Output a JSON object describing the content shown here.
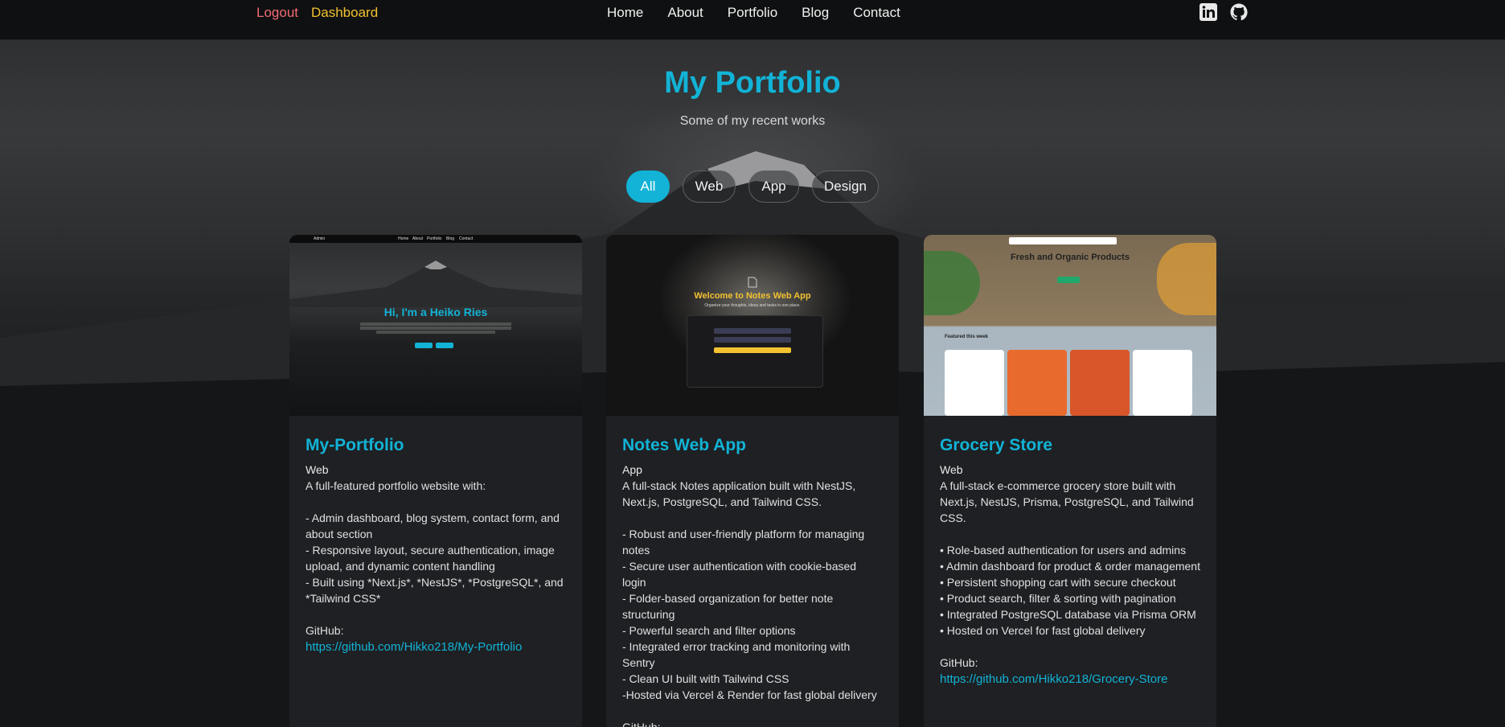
{
  "nav": {
    "logout": "Logout",
    "dashboard": "Dashboard",
    "links": [
      "Home",
      "About",
      "Portfolio",
      "Blog",
      "Contact"
    ],
    "icons": [
      "linkedin-icon",
      "github-icon"
    ]
  },
  "header": {
    "title": "My Portfolio",
    "subtitle": "Some of my recent works"
  },
  "filters": [
    "All",
    "Web",
    "App",
    "Design"
  ],
  "active_filter": "All",
  "projects": [
    {
      "title": "My-Portfolio",
      "category": "Web",
      "description": "A full-featured portfolio website with:\n\n- Admin dashboard, blog system, contact form, and about section\n- Responsive layout, secure authentication, image upload, and dynamic content handling\n- Built using *Next.js*, *NestJS*, *PostgreSQL*, and *Tailwind CSS*",
      "github_label": "GitHub:",
      "github_url": "https://github.com/Hikko218/My-Portfolio",
      "thumb": {
        "heading": "Hi, I'm a Heiko Ries",
        "nav_brand": "Admin",
        "nav_links": [
          "Home",
          "About",
          "Portfolio",
          "Blog",
          "Contact"
        ]
      }
    },
    {
      "title": "Notes Web App",
      "category": "App",
      "description": "A full-stack Notes application built with NestJS, Next.js, PostgreSQL, and Tailwind CSS.\n\n- Robust and user-friendly platform for managing notes\n- Secure user authentication with cookie-based login\n- Folder-based organization for better note structuring\n- Powerful search and filter options\n- Integrated error tracking and monitoring with Sentry\n- Clean UI built with Tailwind CSS\n-Hosted via Vercel & Render for fast global delivery",
      "github_label": "GitHub:",
      "github_url": "",
      "thumb": {
        "heading": "Welcome to Notes Web App",
        "subheading": "Organize your thoughts, ideas and tasks in one place."
      }
    },
    {
      "title": "Grocery Store",
      "category": "Web",
      "description": "A full-stack e-commerce grocery store built with Next.js, NestJS, Prisma, PostgreSQL, and Tailwind CSS.\n\n• Role-based authentication for users and admins\n• Admin dashboard for product & order management\n• Persistent shopping cart with secure checkout\n• Product search, filter & sorting with pagination\n• Integrated PostgreSQL database via Prisma ORM\n• Hosted on Vercel for fast global delivery",
      "github_label": "GitHub:",
      "github_url": "https://github.com/Hikko218/Grocery-Store",
      "thumb": {
        "heading": "Fresh and Organic Products",
        "section": "Featured this week"
      }
    }
  ],
  "colors": {
    "accent": "#12b3d6",
    "logout": "#f06b74",
    "dashboard": "#f2c230"
  }
}
